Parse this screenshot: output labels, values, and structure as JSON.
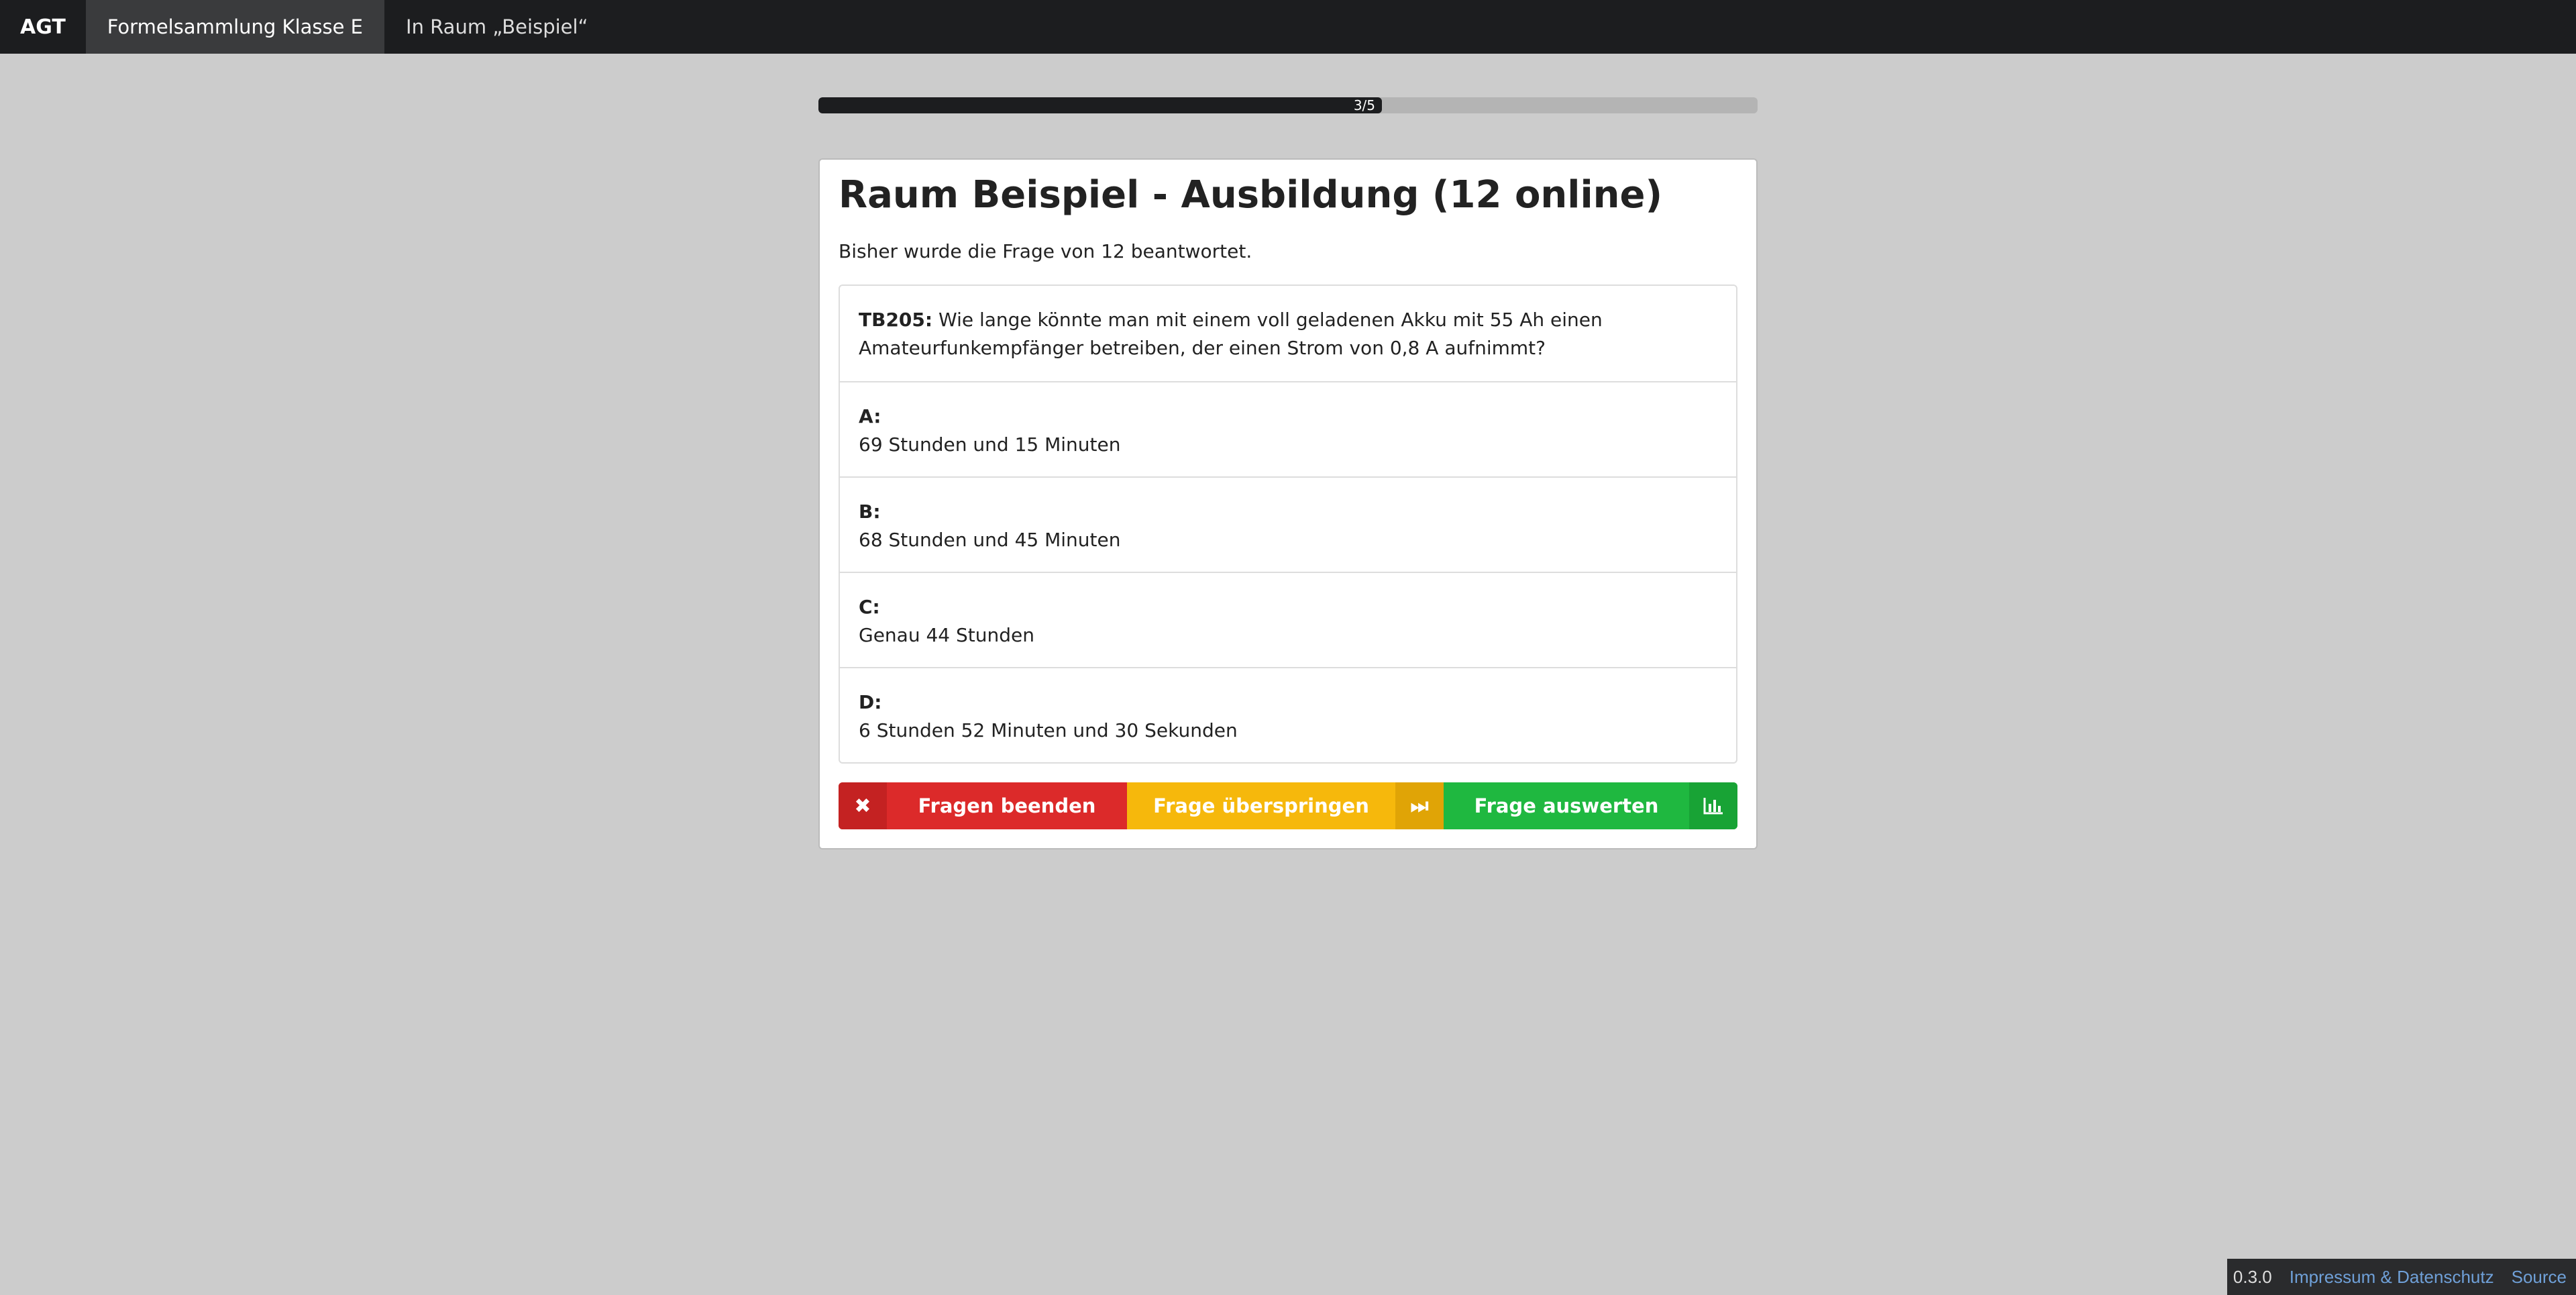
{
  "nav": {
    "brand": "AGT",
    "items": [
      {
        "label": "Formelsammlung Klasse E",
        "active": true
      },
      {
        "label": "In Raum „Beispiel“",
        "active": false
      }
    ]
  },
  "progress": {
    "label": "3/5",
    "current": 3,
    "total": 5,
    "fill_fraction": 0.6,
    "color": "#1c1d1f"
  },
  "room": {
    "title": "Raum Beispiel - Ausbildung (12 online)",
    "answered_text": "Bisher wurde die Frage von 12 beantwortet."
  },
  "question": {
    "id": "TB205:",
    "text": " Wie lange könnte man mit einem voll geladenen Akku mit 55 Ah einen Amateurfunkempfänger betreiben, der einen Strom von 0,8 A aufnimmt?"
  },
  "options": [
    {
      "key": "A:",
      "text": "69 Stunden und 15 Minuten"
    },
    {
      "key": "B:",
      "text": "68 Stunden und 45 Minuten"
    },
    {
      "key": "C:",
      "text": "Genau 44 Stunden"
    },
    {
      "key": "D:",
      "text": "6 Stunden 52 Minuten und 30 Sekunden"
    }
  ],
  "buttons": {
    "end": {
      "label": "Fragen beenden",
      "icon": "close-icon",
      "glyph": "✖",
      "color": "#dc2a2a"
    },
    "skip": {
      "label": "Frage überspringen",
      "icon": "fast-forward-icon",
      "glyph": "⏭",
      "color": "#f6b80c"
    },
    "evaluate": {
      "label": "Frage auswerten",
      "icon": "bar-chart-icon",
      "color": "#1fb840"
    }
  },
  "footer": {
    "version": "0.3.0",
    "imprint_link": "Impressum & Datenschutz",
    "source_link": "Source"
  }
}
